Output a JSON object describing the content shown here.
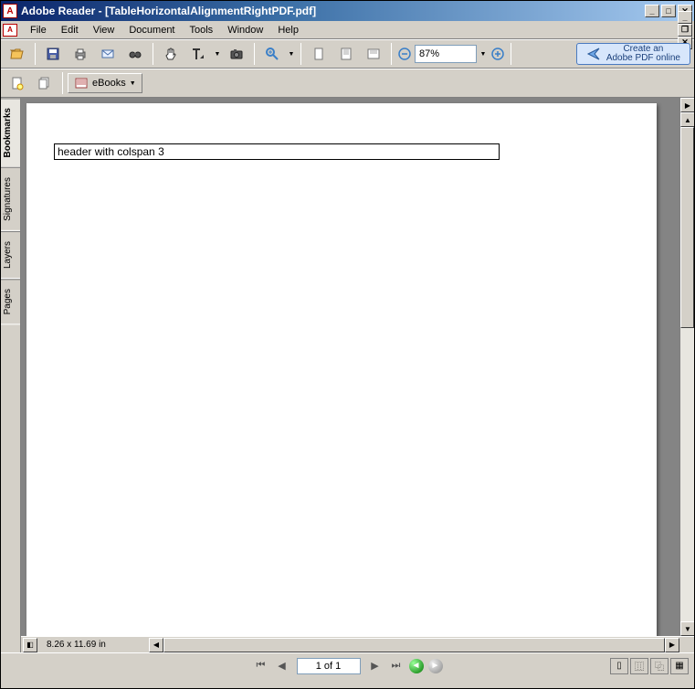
{
  "window": {
    "title": "Adobe Reader - [TableHorizontalAlignmentRightPDF.pdf]"
  },
  "menu": {
    "file": "File",
    "edit": "Edit",
    "view": "View",
    "document": "Document",
    "tools": "Tools",
    "window": "Window",
    "help": "Help"
  },
  "toolbar": {
    "zoom_value": "87%",
    "create_pdf_line1": "Create an",
    "create_pdf_line2": "Adobe PDF online",
    "ebooks": "eBooks"
  },
  "side_tabs": {
    "bookmarks": "Bookmarks",
    "signatures": "Signatures",
    "layers": "Layers",
    "pages": "Pages"
  },
  "document": {
    "cell_text": "header with colspan 3"
  },
  "status": {
    "dimensions": "8.26 x 11.69 in",
    "page_display": "1 of 1"
  }
}
